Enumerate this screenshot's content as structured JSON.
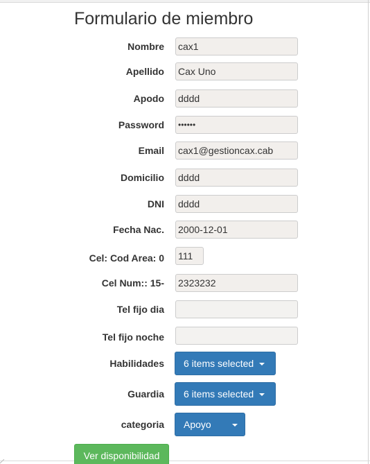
{
  "form": {
    "title": "Formulario de miembro",
    "fields": {
      "nombre": {
        "label": "Nombre",
        "value": "cax1"
      },
      "apellido": {
        "label": "Apellido",
        "value": "Cax Uno"
      },
      "apodo": {
        "label": "Apodo",
        "value": "dddd"
      },
      "password": {
        "label": "Password",
        "value": "••••••"
      },
      "email": {
        "label": "Email",
        "value": "cax1@gestioncax.cab"
      },
      "domicilio": {
        "label": "Domicilio",
        "value": "dddd"
      },
      "dni": {
        "label": "DNI",
        "value": "dddd"
      },
      "fecha": {
        "label": "Fecha Nac.",
        "value": "2000-12-01"
      },
      "cod_area": {
        "label": "Cel: Cod Area: 0",
        "value": "111"
      },
      "cel_num": {
        "label": "Cel Num:: 15-",
        "value": "2323232"
      },
      "tel_dia": {
        "label": "Tel fijo dia",
        "value": ""
      },
      "tel_noche": {
        "label": "Tel fijo noche",
        "value": ""
      }
    },
    "selects": {
      "habilidades": {
        "label": "Habilidades",
        "value": "6 items selected"
      },
      "guardia": {
        "label": "Guardia",
        "value": "6 items selected"
      },
      "categoria": {
        "label": "categoria",
        "value": "Apoyo"
      }
    },
    "button_label": "Ver disponibilidad"
  },
  "colors": {
    "primary": "#337ab7",
    "success": "#5cb85c",
    "input_bg": "#f2efec"
  },
  "icons": {
    "caret": "caret-down-icon"
  }
}
